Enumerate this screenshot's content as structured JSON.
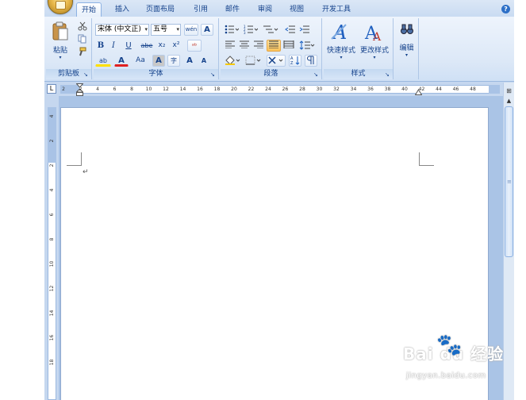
{
  "tabs": [
    {
      "label": "开始",
      "active": true
    },
    {
      "label": "插入"
    },
    {
      "label": "页面布局"
    },
    {
      "label": "引用"
    },
    {
      "label": "邮件"
    },
    {
      "label": "审阅"
    },
    {
      "label": "视图"
    },
    {
      "label": "开发工具"
    }
  ],
  "help_label": "?",
  "clipboard": {
    "paste_label": "粘贴",
    "group_label": "剪贴板"
  },
  "font": {
    "font_name": "宋体 (中文正)",
    "font_size": "五号",
    "phonetic_glyph": "wén",
    "group_label": "字体",
    "bold": "B",
    "italic": "I",
    "underline": "U",
    "strike": "abe",
    "sub": "x₂",
    "sup": "x²",
    "clear": "ᵃᵇ",
    "highlight": "ab",
    "color": "A",
    "case": "Aa",
    "shade": "A",
    "enclose": "字",
    "grow": "A",
    "shrink": "A"
  },
  "paragraph": {
    "group_label": "段落"
  },
  "styles": {
    "quick_label": "快速样式",
    "change_label": "更改样式",
    "group_label": "样式"
  },
  "editing": {
    "label": "编辑",
    "binoculars": "🔍"
  },
  "ruler": {
    "h_ticks": [
      "2",
      "2",
      "4",
      "6",
      "8",
      "10",
      "12",
      "14",
      "16",
      "18",
      "20",
      "22",
      "24",
      "26",
      "28",
      "30",
      "32",
      "34",
      "36",
      "38",
      "40",
      "42",
      "44",
      "46",
      "48"
    ],
    "v_ticks": [
      "4",
      "2",
      "2",
      "4",
      "6",
      "8",
      "10",
      "12",
      "14",
      "16",
      "18"
    ],
    "tab_selector": "L"
  },
  "document": {
    "para_mark": "↵"
  },
  "watermark": {
    "main": "Bai  du 经验",
    "sub": "jingyan.baidu.com"
  },
  "colors": {
    "accent": "#15428b",
    "ribbon_bg": "#dce8f7",
    "highlight_on": "#fbc25a"
  }
}
